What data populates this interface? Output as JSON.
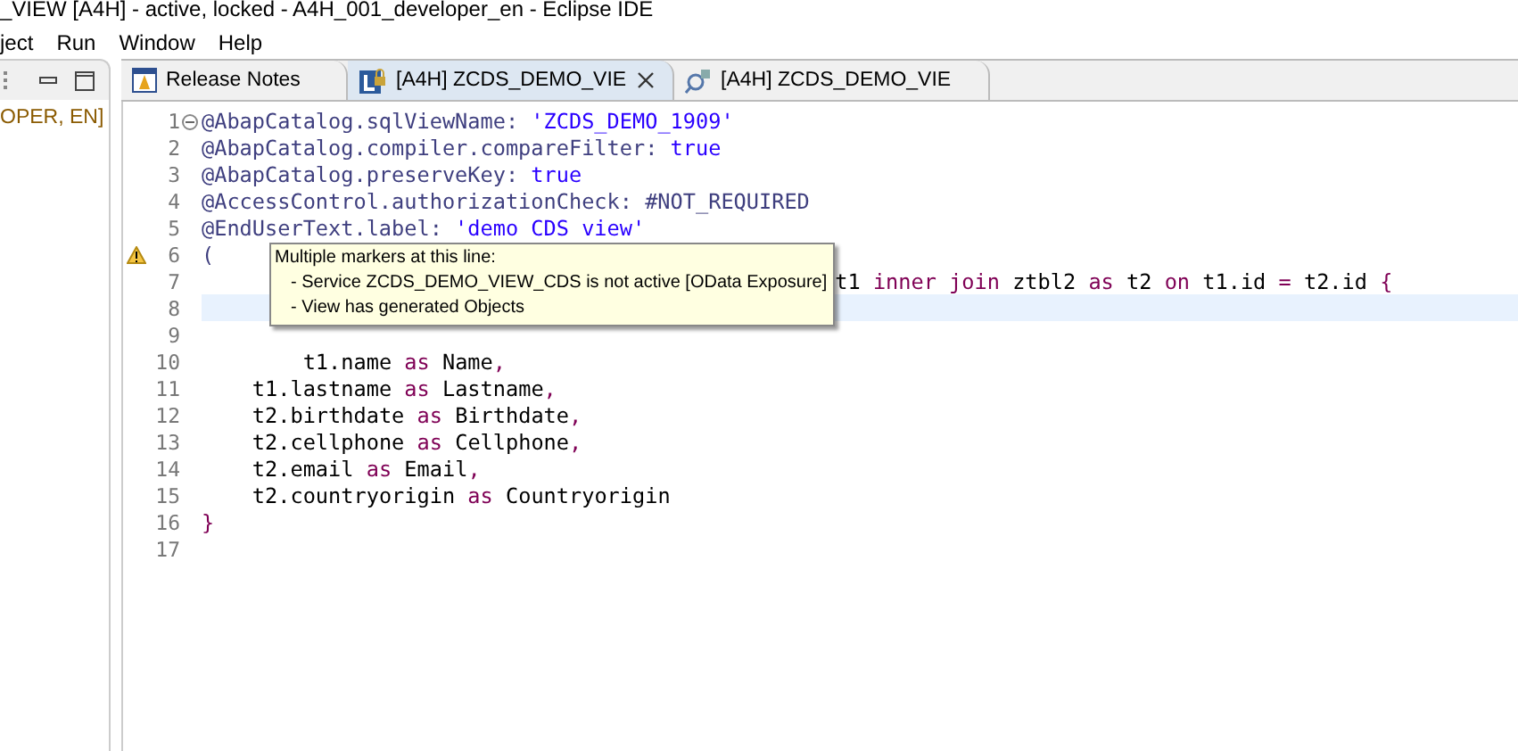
{
  "window": {
    "title": "_VIEW [A4H]  - active, locked - A4H_001_developer_en - Eclipse IDE"
  },
  "menu": [
    "ject",
    "Run",
    "Window",
    "Help"
  ],
  "left_panel": {
    "text": "OPER, EN]"
  },
  "tabs": [
    {
      "label": "Release Notes",
      "kind": "notes",
      "selected": false,
      "closable": false
    },
    {
      "label": "[A4H] ZCDS_DEMO_VIE",
      "kind": "ddl",
      "selected": true,
      "closable": true
    },
    {
      "label": "[A4H] ZCDS_DEMO_VIE",
      "kind": "service",
      "selected": false,
      "closable": false
    }
  ],
  "code": [
    {
      "number": "1",
      "folding": true,
      "warning": false,
      "current": false,
      "tokens": [
        {
          "kind": "plain",
          "text": "@AbapCatalog.sqlViewName: "
        },
        {
          "kind": "string",
          "text": "'ZCDS_DEMO_1909'"
        }
      ]
    },
    {
      "number": "2",
      "folding": false,
      "warning": false,
      "current": false,
      "tokens": [
        {
          "kind": "plain",
          "text": "@AbapCatalog.compiler.compareFilter: "
        },
        {
          "kind": "string",
          "text": "true"
        }
      ]
    },
    {
      "number": "3",
      "folding": false,
      "warning": false,
      "current": false,
      "tokens": [
        {
          "kind": "plain",
          "text": "@AbapCatalog.preserveKey: "
        },
        {
          "kind": "string",
          "text": "true"
        }
      ]
    },
    {
      "number": "4",
      "folding": false,
      "warning": false,
      "current": false,
      "tokens": [
        {
          "kind": "plain",
          "text": "@AccessControl.authorizationCheck: #NOT_REQUIRED"
        }
      ]
    },
    {
      "number": "5",
      "folding": false,
      "warning": false,
      "current": false,
      "tokens": [
        {
          "kind": "plain",
          "text": "@EndUserText.label: "
        },
        {
          "kind": "string",
          "text": "'demo CDS view'"
        }
      ]
    },
    {
      "number": "6",
      "folding": false,
      "warning": true,
      "current": false,
      "tokens": [
        {
          "kind": "plain",
          "text": "("
        }
      ]
    },
    {
      "number": "7",
      "folding": false,
      "warning": false,
      "current": false,
      "tokens": [
        {
          "kind": "ident",
          "text": "                                                  t1 "
        },
        {
          "kind": "keyword",
          "text": "inner join"
        },
        {
          "kind": "ident",
          "text": " ztbl2 "
        },
        {
          "kind": "keyword",
          "text": "as"
        },
        {
          "kind": "ident",
          "text": " t2 "
        },
        {
          "kind": "keyword",
          "text": "on"
        },
        {
          "kind": "ident",
          "text": " t1.id "
        },
        {
          "kind": "keyword",
          "text": "="
        },
        {
          "kind": "ident",
          "text": " t2.id "
        },
        {
          "kind": "keyword",
          "text": "{"
        }
      ]
    },
    {
      "number": "8",
      "folding": false,
      "warning": false,
      "current": true
    },
    {
      "number": "9",
      "folding": false,
      "warning": false,
      "current": false
    },
    {
      "number": "10",
      "folding": false,
      "warning": false,
      "current": false,
      "tokens": [
        {
          "kind": "ident",
          "text": "        t1.name "
        },
        {
          "kind": "keyword",
          "text": "as"
        },
        {
          "kind": "ident",
          "text": " Name"
        },
        {
          "kind": "keyword",
          "text": ","
        }
      ]
    },
    {
      "number": "11",
      "folding": false,
      "warning": false,
      "current": false,
      "tokens": [
        {
          "kind": "ident",
          "text": "    t1.lastname "
        },
        {
          "kind": "keyword",
          "text": "as"
        },
        {
          "kind": "ident",
          "text": " Lastname"
        },
        {
          "kind": "keyword",
          "text": ","
        }
      ]
    },
    {
      "number": "12",
      "folding": false,
      "warning": false,
      "current": false,
      "tokens": [
        {
          "kind": "ident",
          "text": "    t2.birthdate "
        },
        {
          "kind": "keyword",
          "text": "as"
        },
        {
          "kind": "ident",
          "text": " Birthdate"
        },
        {
          "kind": "keyword",
          "text": ","
        }
      ]
    },
    {
      "number": "13",
      "folding": false,
      "warning": false,
      "current": false,
      "tokens": [
        {
          "kind": "ident",
          "text": "    t2.cellphone "
        },
        {
          "kind": "keyword",
          "text": "as"
        },
        {
          "kind": "ident",
          "text": " Cellphone"
        },
        {
          "kind": "keyword",
          "text": ","
        }
      ]
    },
    {
      "number": "14",
      "folding": false,
      "warning": false,
      "current": false,
      "tokens": [
        {
          "kind": "ident",
          "text": "    t2.email "
        },
        {
          "kind": "keyword",
          "text": "as"
        },
        {
          "kind": "ident",
          "text": " Email"
        },
        {
          "kind": "keyword",
          "text": ","
        }
      ]
    },
    {
      "number": "15",
      "folding": false,
      "warning": false,
      "current": false,
      "tokens": [
        {
          "kind": "ident",
          "text": "    t2.countryorigin "
        },
        {
          "kind": "keyword",
          "text": "as"
        },
        {
          "kind": "ident",
          "text": " Countryorigin"
        }
      ]
    },
    {
      "number": "16",
      "folding": false,
      "warning": false,
      "current": false,
      "tokens": [
        {
          "kind": "keyword",
          "text": "}"
        }
      ]
    },
    {
      "number": "17",
      "folding": false,
      "warning": false,
      "current": false
    }
  ],
  "tooltip": {
    "title": "Multiple markers at this line:",
    "items": [
      "- Service ZCDS_DEMO_VIEW_CDS is not active [OData Exposure]",
      "- View has generated Objects"
    ]
  }
}
